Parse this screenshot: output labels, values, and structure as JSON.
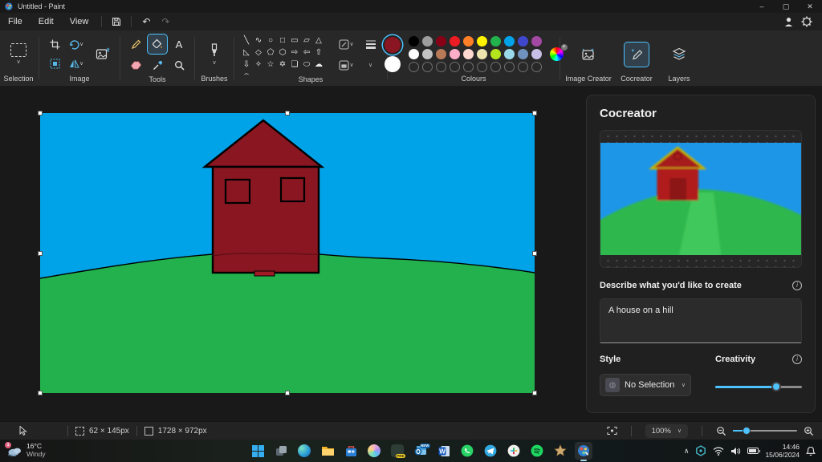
{
  "titlebar": {
    "title": "Untitled - Paint"
  },
  "menubar": {
    "items": [
      "File",
      "Edit",
      "View"
    ]
  },
  "ribbon": {
    "groups": {
      "selection": {
        "label": "Selection"
      },
      "image": {
        "label": "Image"
      },
      "tools": {
        "label": "Tools",
        "text_glyph": "A"
      },
      "brushes": {
        "label": "Brushes"
      },
      "shapes": {
        "label": "Shapes",
        "glyphs": [
          "╲",
          "∿",
          "○",
          "□",
          "▭",
          "▱",
          "△",
          "◺",
          "◇",
          "⬠",
          "⬡",
          "⇨",
          "⇦",
          "⇧",
          "⇩",
          "✧",
          "☆",
          "✡",
          "❏",
          "⬭",
          "☁",
          "◠",
          "⌣"
        ]
      },
      "colours": {
        "label": "Colours",
        "colour1": "#891620",
        "colour2": "#FFFFFF",
        "palette": [
          "#000000",
          "#9D9D9D",
          "#880015",
          "#ED1C24",
          "#FF7F27",
          "#FFF200",
          "#22B14C",
          "#00A2E8",
          "#3F48CC",
          "#A349A4",
          "#FFFFFF",
          "#C3C3C3",
          "#B97A57",
          "#FFAEC9",
          "#FFD9CF",
          "#EFE4B0",
          "#B5E61D",
          "#99D9EA",
          "#7092BE",
          "#C8BFE7"
        ],
        "empty_slots": 10
      },
      "image_creator": {
        "label": "Image Creator"
      },
      "cocreator": {
        "label": "Cocreator"
      },
      "layers": {
        "label": "Layers"
      }
    }
  },
  "canvas": {
    "sky": "#00A2E8",
    "grass": "#22B14C",
    "house": "#891620",
    "outline": "#000000"
  },
  "cocreator_panel": {
    "title": "Cocreator",
    "describe_label": "Describe what you'd like to create",
    "prompt_value": "A house on a hill",
    "style_label": "Style",
    "style_value": "No Selection",
    "creativity_label": "Creativity",
    "creativity_percent": 70,
    "accent": "#4CC2FF"
  },
  "statusbar": {
    "selection_size": "62 × 145px",
    "canvas_size": "1728 × 972px",
    "zoom_level": "100%"
  },
  "taskbar": {
    "weather_temp": "16°C",
    "weather_desc": "Windy",
    "weather_badge": "1",
    "icons": [
      "start",
      "task-view",
      "edge",
      "file-explorer",
      "microsoft-store",
      "copilot",
      "game-pass",
      "outlook",
      "word",
      "whatsapp",
      "telegram",
      "slack",
      "spotify",
      "game",
      "paint"
    ],
    "word_letter": "W",
    "pre_badge": "PRE",
    "new_badge": "NEW",
    "time": "14:46",
    "date": "15/06/2024"
  }
}
